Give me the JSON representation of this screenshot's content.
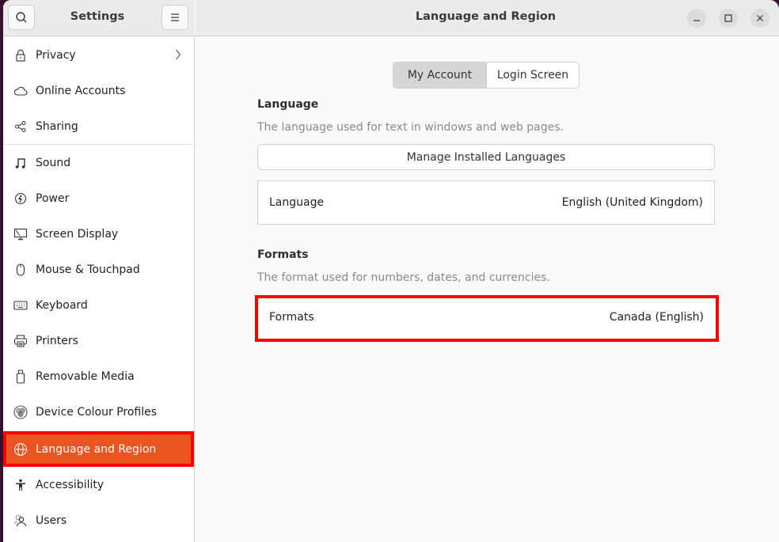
{
  "sidebar": {
    "title": "Settings",
    "search_icon": "search-icon",
    "menu_icon": "hamburger-menu-icon",
    "items": [
      {
        "label": "Privacy",
        "icon": "lock-icon",
        "has_chevron": true
      },
      {
        "label": "Online Accounts",
        "icon": "cloud-icon"
      },
      {
        "label": "Sharing",
        "icon": "share-icon"
      },
      {
        "label": "Sound",
        "icon": "music-note-icon"
      },
      {
        "label": "Power",
        "icon": "power-icon"
      },
      {
        "label": "Screen Display",
        "icon": "display-icon"
      },
      {
        "label": "Mouse & Touchpad",
        "icon": "mouse-icon"
      },
      {
        "label": "Keyboard",
        "icon": "keyboard-icon"
      },
      {
        "label": "Printers",
        "icon": "printer-icon"
      },
      {
        "label": "Removable Media",
        "icon": "usb-drive-icon"
      },
      {
        "label": "Device Colour Profiles",
        "icon": "colour-profile-icon"
      },
      {
        "label": "Language and Region",
        "icon": "globe-icon",
        "active": true
      },
      {
        "label": "Accessibility",
        "icon": "accessibility-icon"
      },
      {
        "label": "Users",
        "icon": "users-icon"
      }
    ],
    "accent_color": "#e95420",
    "highlight_color": "#ff0000"
  },
  "header": {
    "title": "Language and Region",
    "window_controls": [
      "minimize",
      "maximize",
      "close"
    ]
  },
  "tabs": [
    {
      "label": "My Account",
      "active": true
    },
    {
      "label": "Login Screen",
      "active": false
    }
  ],
  "language_section": {
    "title": "Language",
    "description": "The language used for text in windows and web pages.",
    "manage_button": "Manage Installed Languages",
    "row_label": "Language",
    "row_value": "English (United Kingdom)"
  },
  "formats_section": {
    "title": "Formats",
    "description": "The format used for numbers, dates, and currencies.",
    "row_label": "Formats",
    "row_value": "Canada (English)"
  }
}
